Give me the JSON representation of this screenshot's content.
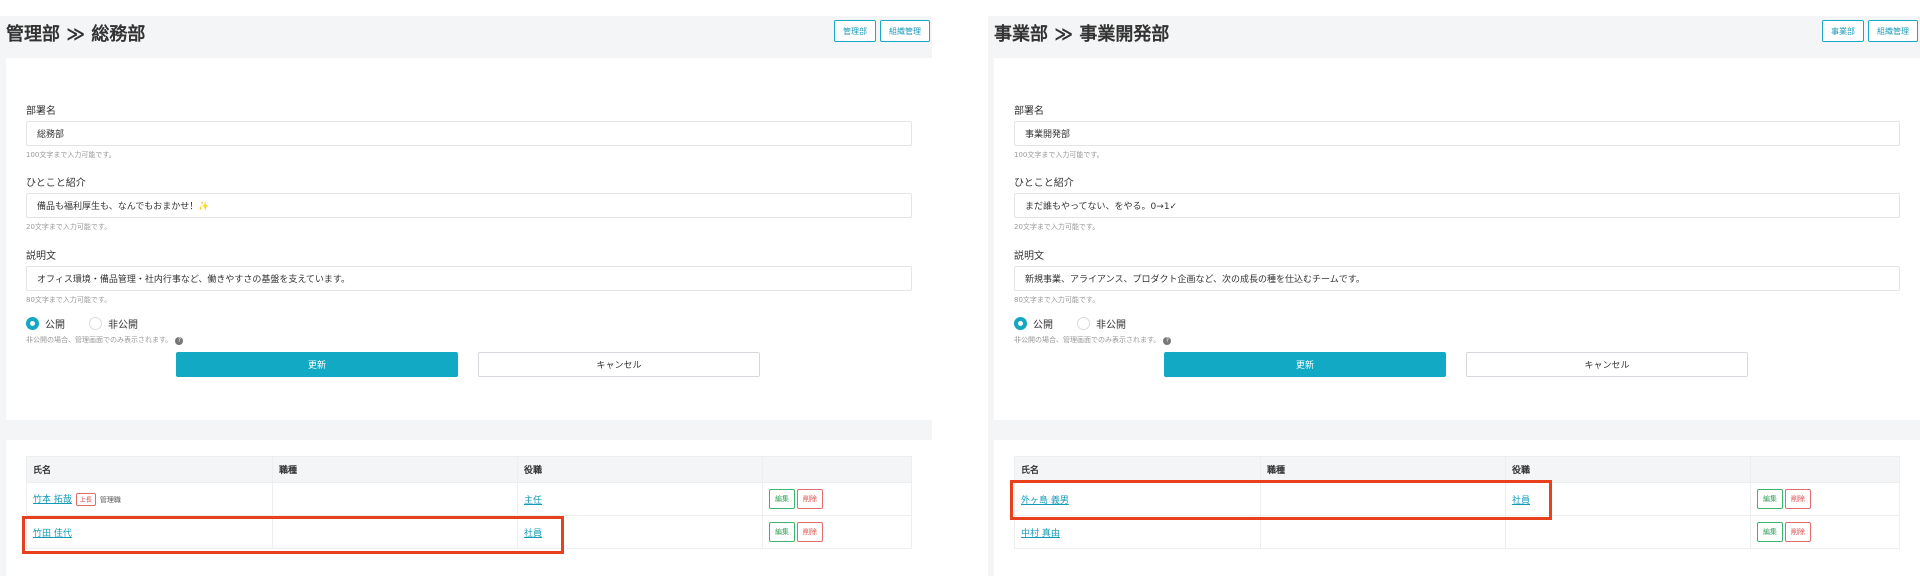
{
  "left": {
    "title": "管理部 ≫ 総務部",
    "header_buttons": [
      "管理部",
      "組織管理"
    ],
    "form": {
      "dept_label": "部署名",
      "dept_value": "総務部",
      "dept_hint": "100文字まで入力可能です。",
      "intro_label": "ひとこと紹介",
      "intro_value": "備品も福利厚生も、なんでもおまかせ！✨",
      "intro_hint": "20文字まで入力可能です。",
      "desc_label": "説明文",
      "desc_value": "オフィス環境・備品管理・社内行事など、働きやすさの基盤を支えています。",
      "desc_hint": "80文字まで入力可能です。",
      "radio_public": "公開",
      "radio_private": "非公開",
      "visibility_hint": "非公開の場合、管理画面でのみ表示されます。",
      "update_button": "更新",
      "cancel_button": "キャンセル"
    },
    "table": {
      "headers": [
        "氏名",
        "職種",
        "役職",
        ""
      ],
      "rows": [
        {
          "name": "竹本 拓哉",
          "badge": "上長",
          "note": "管理職",
          "job": "",
          "position": "主任",
          "edit": "編集",
          "delete": "削除"
        },
        {
          "name": "竹田 佳代",
          "badge": "",
          "note": "",
          "job": "",
          "position": "社員",
          "edit": "編集",
          "delete": "削除"
        }
      ]
    }
  },
  "right": {
    "title": "事業部 ≫ 事業開発部",
    "header_buttons": [
      "事業部",
      "組織管理"
    ],
    "form": {
      "dept_label": "部署名",
      "dept_value": "事業開発部",
      "dept_hint": "100文字まで入力可能です。",
      "intro_label": "ひとこと紹介",
      "intro_value": "まだ誰もやってない、をやる。0→1✓",
      "intro_hint": "20文字まで入力可能です。",
      "desc_label": "説明文",
      "desc_value": "新規事業、アライアンス、プロダクト企画など、次の成長の種を仕込むチームです。",
      "desc_hint": "80文字まで入力可能です。",
      "radio_public": "公開",
      "radio_private": "非公開",
      "visibility_hint": "非公開の場合、管理画面でのみ表示されます。",
      "update_button": "更新",
      "cancel_button": "キャンセル"
    },
    "table": {
      "headers": [
        "氏名",
        "職種",
        "役職",
        ""
      ],
      "rows": [
        {
          "name": "外ヶ島 義男",
          "badge": "",
          "note": "",
          "job": "",
          "position": "社員",
          "edit": "編集",
          "delete": "削除"
        },
        {
          "name": "中村 真由",
          "badge": "",
          "note": "",
          "job": "",
          "position": "",
          "edit": "編集",
          "delete": "削除"
        }
      ]
    }
  },
  "colors": {
    "accent": "#12a9c4",
    "highlight": "#e8401c",
    "edit": "#3bb56b",
    "delete": "#e06b6b"
  },
  "icons": [
    "help-circle-icon"
  ]
}
